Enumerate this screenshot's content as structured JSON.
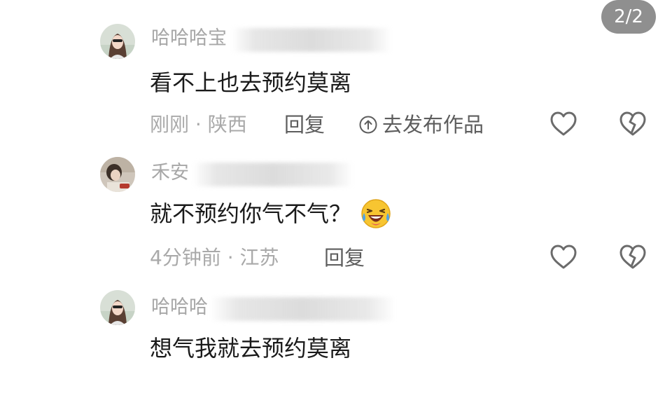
{
  "page_indicator": "2/2",
  "comments": [
    {
      "username": "哈哈哈宝",
      "text": "看不上也去预约莫离",
      "meta": "刚刚 · 陕西",
      "reply_label": "回复",
      "publish_label": "去发布作品"
    },
    {
      "username": "禾安",
      "text": "就不预约你气不气？",
      "meta": "4分钟前 · 江苏",
      "reply_label": "回复"
    },
    {
      "username": "哈哈哈",
      "text": "想气我就去预约莫离"
    }
  ],
  "icons": {
    "like": "heart-outline-icon",
    "dislike": "broken-heart-icon",
    "publish": "up-arrow-circle-icon",
    "emoji": "laughing-tears-emoji"
  },
  "colors": {
    "meta_text": "#a9a9a9",
    "action_text": "#5d5d5d",
    "icon_stroke": "#6b6b6b",
    "badge_bg": "#8f8f8f"
  }
}
